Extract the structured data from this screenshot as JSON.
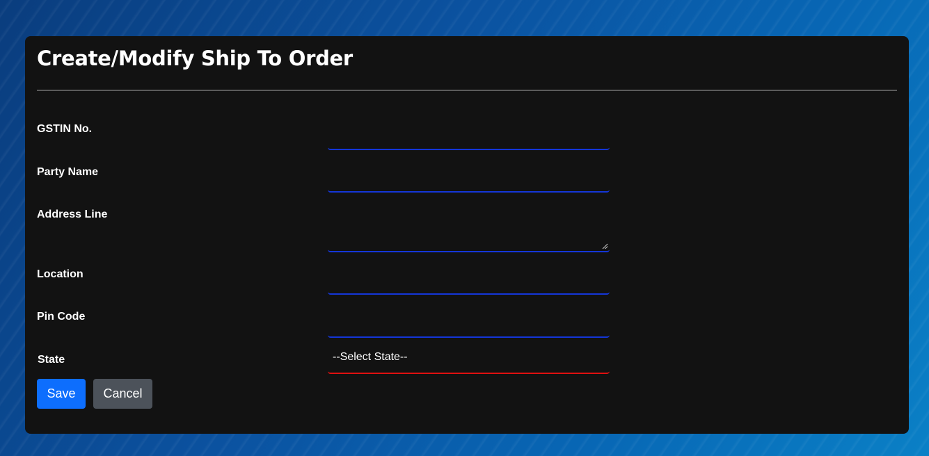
{
  "form": {
    "title": "Create/Modify Ship To Order",
    "fields": {
      "gstin": {
        "label": "GSTIN No.",
        "value": ""
      },
      "party_name": {
        "label": "Party Name",
        "value": ""
      },
      "address_line": {
        "label": "Address Line",
        "value": ""
      },
      "location": {
        "label": "Location",
        "value": ""
      },
      "pin_code": {
        "label": "Pin Code",
        "value": ""
      },
      "state": {
        "label": "State",
        "selected": "--Select State--"
      }
    },
    "buttons": {
      "save": "Save",
      "cancel": "Cancel"
    }
  },
  "colors": {
    "card_bg": "#121212",
    "input_underline": "#1436d8",
    "select_underline_error": "#e01010",
    "save_button": "#0d6efd",
    "cancel_button": "#4c525a"
  },
  "icons": {
    "textarea_resize": "resize-grip-icon"
  }
}
